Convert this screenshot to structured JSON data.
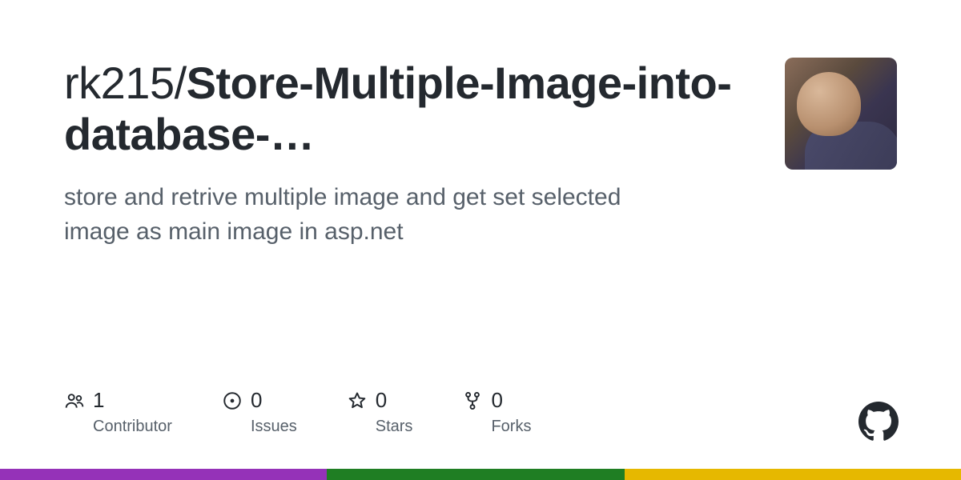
{
  "repo": {
    "owner": "rk215",
    "separator": "/",
    "name_display": "Store-Multiple-Image-into-database-…",
    "description": "store and retrive multiple image and get set selected image as main image in asp.net"
  },
  "stats": {
    "contributors": {
      "value": "1",
      "label": "Contributor"
    },
    "issues": {
      "value": "0",
      "label": "Issues"
    },
    "stars": {
      "value": "0",
      "label": "Stars"
    },
    "forks": {
      "value": "0",
      "label": "Forks"
    }
  },
  "colors": {
    "bar": [
      {
        "color": "#9532b8",
        "width": "34%"
      },
      {
        "color": "#1f7e23",
        "width": "31%"
      },
      {
        "color": "#e6b800",
        "width": "35%"
      }
    ]
  }
}
